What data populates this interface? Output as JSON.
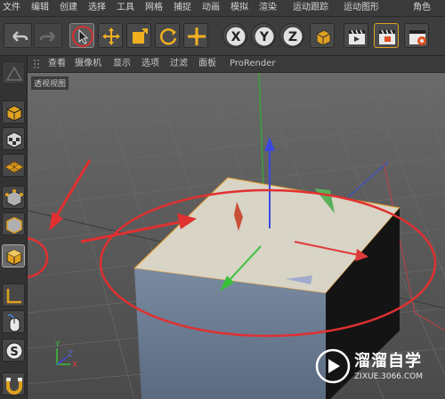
{
  "menubar": {
    "items": [
      "文件",
      "编辑",
      "创建",
      "选择",
      "工具",
      "网格",
      "捕捉",
      "动画",
      "模拟",
      "渲染",
      "运动跟踪",
      "运动图形",
      "角色"
    ]
  },
  "toolbar": {
    "axis_x": "X",
    "axis_y": "Y",
    "axis_z": "Z"
  },
  "viewport_menu": {
    "items": [
      "查看",
      "摄像机",
      "显示",
      "选项",
      "过滤",
      "面板",
      "ProRender"
    ]
  },
  "viewport": {
    "label": "透视视图",
    "gizmo_y": "Y",
    "gizmo_z": "Z",
    "gizmo_x": "X"
  },
  "watermark": {
    "title": "溜溜自学",
    "url": "ZIXUE.3066.COM"
  },
  "colors": {
    "annotation_red": "#e03030",
    "cube_top": "#d8d4c6",
    "cube_side": "#6e7f96",
    "selection_outline": "#f0a030",
    "axis_x": "#e03a3a",
    "axis_y": "#3ac03a",
    "axis_z": "#3a4ae0"
  }
}
